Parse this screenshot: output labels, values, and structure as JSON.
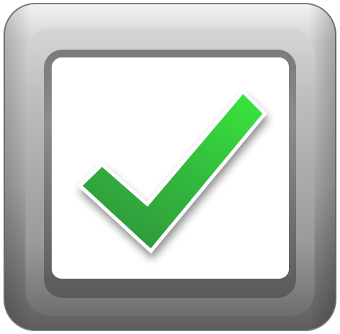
{
  "checkbox": {
    "state": "checked",
    "icon": "checkmark-icon",
    "colors": {
      "frame_light": "#f0f0f0",
      "frame_mid": "#c4c4c4",
      "frame_dark": "#5e5e5e",
      "face": "#ffffff",
      "check_light": "#39e03c",
      "check_dark": "#2e9a3c",
      "check_outline": "#ffffff"
    }
  }
}
